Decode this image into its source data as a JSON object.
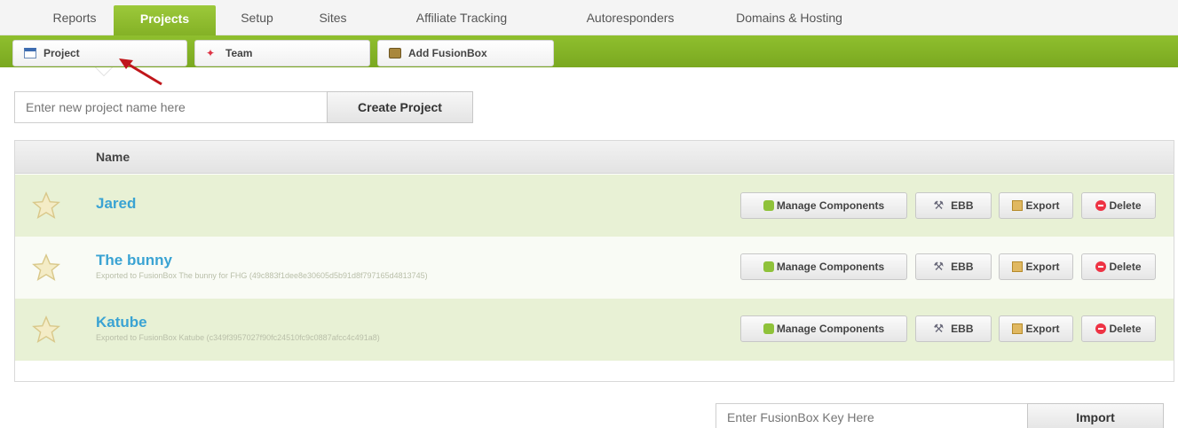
{
  "nav": {
    "tabs": [
      {
        "label": "Reports"
      },
      {
        "label": "Projects"
      },
      {
        "label": "Setup"
      },
      {
        "label": "Sites"
      },
      {
        "label": "Affiliate Tracking"
      },
      {
        "label": "Autoresponders"
      },
      {
        "label": "Domains & Hosting"
      }
    ],
    "active": "Projects"
  },
  "subnav": {
    "tabs": [
      {
        "label": "Project",
        "icon": "project-icon"
      },
      {
        "label": "Team",
        "icon": "team-icon"
      },
      {
        "label": "Add FusionBox",
        "icon": "fusionbox-icon"
      }
    ],
    "active": "Project"
  },
  "create": {
    "placeholder": "Enter new project name here",
    "button_label": "Create Project"
  },
  "table": {
    "header_name": "Name",
    "rows": [
      {
        "name": "Jared",
        "subtitle": ""
      },
      {
        "name": "The bunny",
        "subtitle": "Exported to FusionBox The bunny for FHG (49c883f1dee8e30605d5b91d8f797165d4813745)"
      },
      {
        "name": "Katube",
        "subtitle": "Exported to FusionBox Katube (c349f3957027f90fc24510fc9c0887afcc4c491a8)"
      }
    ],
    "actions": {
      "manage": "Manage Components",
      "ebb": "EBB",
      "export": "Export",
      "delete": "Delete"
    }
  },
  "import": {
    "placeholder": "Enter FusionBox Key Here",
    "button_label": "Import"
  },
  "colors": {
    "accent_green": "#8fbf2e",
    "link_blue": "#3aa3d3",
    "row_green": "#e8f1d5",
    "annotation_red": "#c0161b"
  }
}
